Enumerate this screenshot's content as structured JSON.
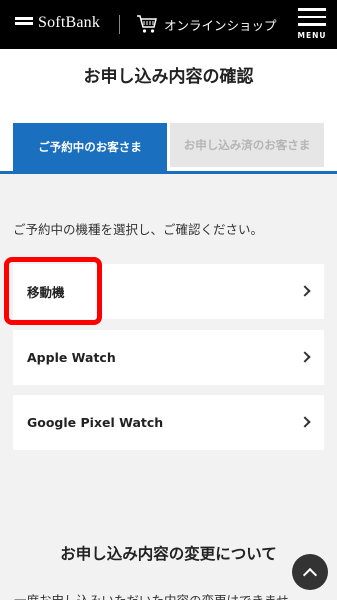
{
  "header": {
    "brand": "SoftBank",
    "shop_label": "オンラインショップ",
    "menu_label": "MENU",
    "icons": [
      "softbank-logo-icon",
      "cart-icon",
      "hamburger-menu-icon"
    ]
  },
  "page": {
    "title": "お申し込み内容の確認"
  },
  "tabs": [
    {
      "label": "ご予約中のお客さま",
      "active": true
    },
    {
      "label": "お申し込み済のお客さま",
      "active": false
    }
  ],
  "instruction": "ご予約中の機種を選択し、ご確認ください。",
  "options": [
    {
      "label": "移動機"
    },
    {
      "label": "Apple Watch"
    },
    {
      "label": "Google Pixel Watch"
    }
  ],
  "change_section": {
    "title": "お申し込み内容の変更について",
    "body": "一度お申し込みいただいた内容の変更はできませ"
  },
  "colors": {
    "header_bg": "#000000",
    "accent_blue": "#1a6fbf",
    "highlight_red": "#ff0000"
  }
}
